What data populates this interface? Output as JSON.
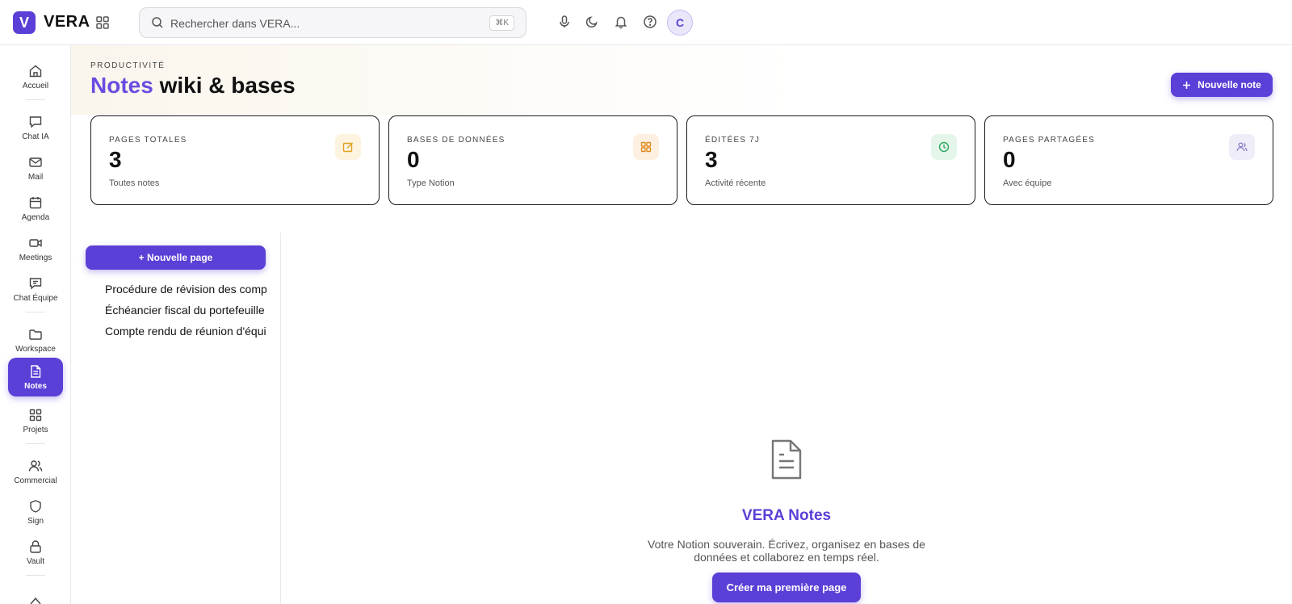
{
  "app": {
    "logo_letter": "V",
    "name": "VERA"
  },
  "search": {
    "placeholder": "Rechercher dans VERA...",
    "shortcut": "⌘K"
  },
  "user": {
    "avatar_initial": "C"
  },
  "sidebar": {
    "items": [
      {
        "label": "Accueil",
        "icon": "home-icon"
      },
      {
        "label": "Chat IA",
        "icon": "chat-icon"
      },
      {
        "label": "Mail",
        "icon": "mail-icon"
      },
      {
        "label": "Agenda",
        "icon": "calendar-icon"
      },
      {
        "label": "Meetings",
        "icon": "video-icon"
      },
      {
        "label": "Chat Équipe",
        "icon": "team-chat-icon"
      },
      {
        "label": "Workspace",
        "icon": "folder-icon"
      },
      {
        "label": "Notes",
        "icon": "document-icon",
        "active": true
      },
      {
        "label": "Projets",
        "icon": "grid-icon"
      },
      {
        "label": "Commercial",
        "icon": "users-icon"
      },
      {
        "label": "Sign",
        "icon": "shield-icon"
      },
      {
        "label": "Vault",
        "icon": "lock-icon"
      }
    ]
  },
  "header": {
    "eyebrow": "PRODUCTIVITÉ",
    "title_accent": "Notes",
    "title_rest": "wiki & bases",
    "new_note_label": "Nouvelle note"
  },
  "stats": [
    {
      "label": "PAGES TOTALES",
      "value": "3",
      "sub": "Toutes notes",
      "icon": "edit-icon",
      "icon_color": "#e0a020",
      "icon_bg": "#fdf4e0"
    },
    {
      "label": "BASES DE DONNÉES",
      "value": "0",
      "sub": "Type Notion",
      "icon": "database-grid-icon",
      "icon_color": "#e08a20",
      "icon_bg": "#fdf0e0"
    },
    {
      "label": "ÉDITÉES 7J",
      "value": "3",
      "sub": "Activité récente",
      "icon": "clock-icon",
      "icon_color": "#2fa860",
      "icon_bg": "#e4f6ea"
    },
    {
      "label": "PAGES PARTAGÉES",
      "value": "0",
      "sub": "Avec équipe",
      "icon": "users-icon",
      "icon_color": "#8a80c8",
      "icon_bg": "#efedf8"
    }
  ],
  "pages": {
    "new_page_label": "+ Nouvelle page",
    "items": [
      "Procédure de révision des comptes",
      "Échéancier fiscal du portefeuille",
      "Compte rendu de réunion d'équipe"
    ]
  },
  "empty_state": {
    "title": "VERA Notes",
    "description": "Votre Notion souverain. Écrivez, organisez en bases de données et collaborez en temps réel.",
    "cta_label": "Créer ma première page"
  },
  "colors": {
    "accent": "#5b3fd6",
    "accent_light": "#6a4ce0"
  }
}
